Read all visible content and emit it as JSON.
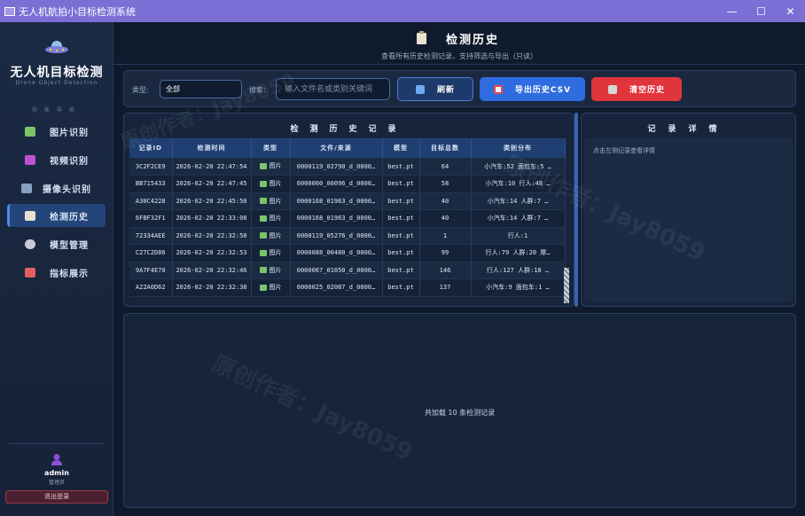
{
  "window": {
    "title": "无人机航拍小目标检测系统",
    "controls": {
      "minimize": "—",
      "maximize": "☐",
      "close": "✕"
    }
  },
  "sidebar": {
    "brand_title": "无人机目标检测",
    "brand_subtitle": "Drone Object Detection",
    "nav_caption": "功能导航",
    "items": [
      {
        "label": "图片识别",
        "icon": "image-icon",
        "icon_color": "#7cc46a",
        "active": false
      },
      {
        "label": "视频识别",
        "icon": "video-icon",
        "icon_color": "#c24fd0",
        "active": false
      },
      {
        "label": "摄像头识别",
        "icon": "camera-icon",
        "icon_color": "#8aa0c0",
        "active": false
      },
      {
        "label": "检测历史",
        "icon": "clipboard-icon",
        "icon_color": "#e8e2d0",
        "active": true
      },
      {
        "label": "模型管理",
        "icon": "gear-icon",
        "icon_color": "#c8ccd4",
        "active": false
      },
      {
        "label": "指标展示",
        "icon": "bar-chart-icon",
        "icon_color": "#e06060",
        "active": false
      }
    ],
    "user": {
      "name": "admin",
      "role": "管理员"
    },
    "logout_label": "退出登录"
  },
  "header": {
    "title": "检测历史",
    "subtitle": "查看所有历史检测记录，支持筛选与导出（只读）"
  },
  "toolbar": {
    "type_label": "类型:",
    "type_value": "全部",
    "search_label": "搜索:",
    "search_placeholder": "输入文件名或类别关键词",
    "refresh_label": "刷新",
    "export_label": "导出历史CSV",
    "clear_label": "清空历史"
  },
  "history": {
    "title": "检测历史记录",
    "columns": [
      "记录ID",
      "检测时间",
      "类型",
      "文件/来源",
      "模型",
      "目标总数",
      "类别分布"
    ],
    "rows": [
      {
        "id": "3C2F2CE9",
        "time": "2026-02-20 22:47:54",
        "type": "图片",
        "file": "0000119_02790_d_0000…",
        "model": "best.pt",
        "total": "64",
        "dist": "小汽车:52  面包车:5 …"
      },
      {
        "id": "BB715433",
        "time": "2026-02-20 22:47:45",
        "type": "图片",
        "file": "0000000_00096_d_0000…",
        "model": "best.pt",
        "total": "58",
        "dist": "小汽车:10  行人:48  …"
      },
      {
        "id": "A30C4228",
        "time": "2026-02-20 22:45:50",
        "type": "图片",
        "file": "0000168_01963_d_0000…",
        "model": "best.pt",
        "total": "40",
        "dist": "小汽车:14  人群:7  …"
      },
      {
        "id": "6FBF32F1",
        "time": "2026-02-20 22:33:08",
        "type": "图片",
        "file": "0000168_01963_d_0000…",
        "model": "best.pt",
        "total": "40",
        "dist": "小汽车:14  人群:7  …"
      },
      {
        "id": "72334AEE",
        "time": "2026-02-20 22:32:58",
        "type": "图片",
        "file": "0000119_05276_d_0000…",
        "model": "best.pt",
        "total": "1",
        "dist": "行人:1"
      },
      {
        "id": "C27C2D86",
        "time": "2026-02-20 22:32:53",
        "type": "图片",
        "file": "0000088_00480_d_0000…",
        "model": "best.pt",
        "total": "99",
        "dist": "行人:79  人群:20  摩…"
      },
      {
        "id": "9A7F4E70",
        "time": "2026-02-20 22:32:46",
        "type": "图片",
        "file": "0000067_01050_d_0000…",
        "model": "best.pt",
        "total": "146",
        "dist": "行人:127  人群:18  …"
      },
      {
        "id": "A22A0D62",
        "time": "2026-02-20 22:32:38",
        "type": "图片",
        "file": "0000025_02087_d_0000…",
        "model": "best.pt",
        "total": "137",
        "dist": "小汽车:9  面包车:1  …"
      }
    ]
  },
  "detail": {
    "title": "记录详情",
    "hint": "点击左侧记录查看详情"
  },
  "footer_status": "共加载 10 条检测记录",
  "watermark": "原创作者：Jay8059"
}
